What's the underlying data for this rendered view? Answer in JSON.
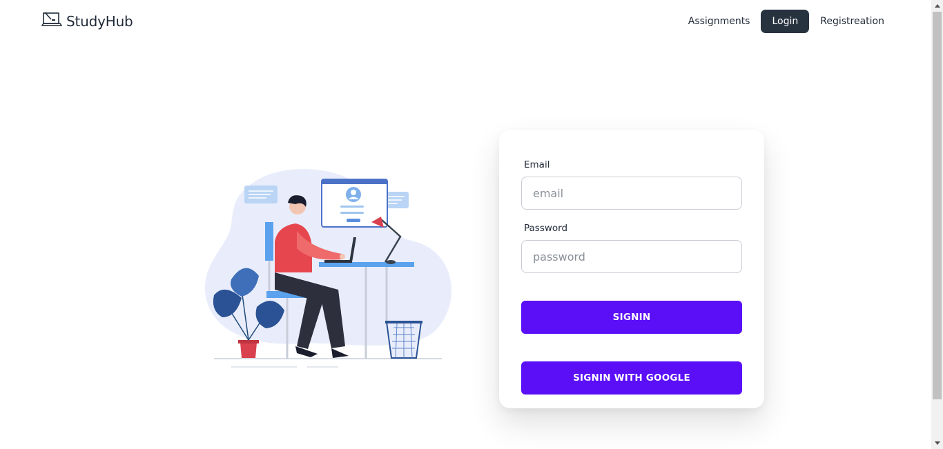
{
  "brand": {
    "name": "StudyHub",
    "logo_icon": "laptop-icon"
  },
  "nav": {
    "items": [
      {
        "label": "Assignments",
        "active": false
      },
      {
        "label": "Login",
        "active": true
      },
      {
        "label": "Registreation",
        "active": false
      }
    ]
  },
  "illustration": {
    "subject": "person-at-laptop-login-illustration"
  },
  "form": {
    "email_label": "Email",
    "email_placeholder": "email",
    "email_value": "",
    "password_label": "Password",
    "password_placeholder": "password",
    "password_value": "",
    "signin_label": "SIGNIN",
    "google_label": "SIGNIN WITH GOOGLE"
  },
  "colors": {
    "primary_button": "#5b0ff7",
    "active_nav": "#283340"
  }
}
